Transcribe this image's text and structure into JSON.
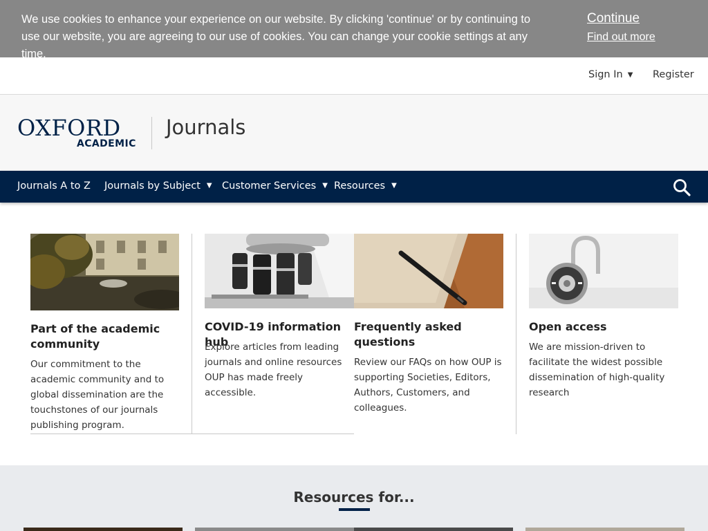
{
  "cookie": {
    "message": "We use cookies to enhance your experience on our website. By clicking 'continue' or by continuing to use our website, you are agreeing to our use of cookies. You can change your cookie settings at any time.",
    "continue_label": "Continue",
    "find_out_more_label": "Find out more"
  },
  "utility": {
    "sign_in_label": "Sign In",
    "register_label": "Register"
  },
  "brand": {
    "logo_top": "OXFORD",
    "logo_bottom": "ACADEMIC",
    "section_title": "Journals"
  },
  "nav": {
    "items": [
      {
        "label": "Journals A to Z",
        "has_dropdown": false
      },
      {
        "label": "Journals by Subject",
        "has_dropdown": true
      },
      {
        "label": "Customer Services",
        "has_dropdown": true
      },
      {
        "label": "Resources",
        "has_dropdown": true
      }
    ],
    "search_icon": "search-icon"
  },
  "cards": [
    {
      "title": "Part of the academic community",
      "description": "Our commitment to the academic community and to global dissemination are the touchstones of our journals publishing program.",
      "image": "oxford-building-fountain-photo"
    },
    {
      "title": "COVID-19 information hub",
      "description": "Explore articles from leading journals and online resources OUP has made freely accessible.",
      "image": "microscope-photo"
    },
    {
      "title": "Frequently asked questions",
      "description": "Review our FAQs on how OUP is supporting Societies, Editors, Authors, Customers, and colleagues.",
      "image": "notebook-pen-photo"
    },
    {
      "title": "Open access",
      "description": "We are mission-driven to facilitate the widest possible dissemination of high-quality research",
      "image": "open-padlock-photo"
    }
  ],
  "resources": {
    "title": "Resources for..."
  },
  "colors": {
    "navy": "#002147",
    "cookie_bg": "#878787",
    "resources_bg": "#e9ebee"
  }
}
